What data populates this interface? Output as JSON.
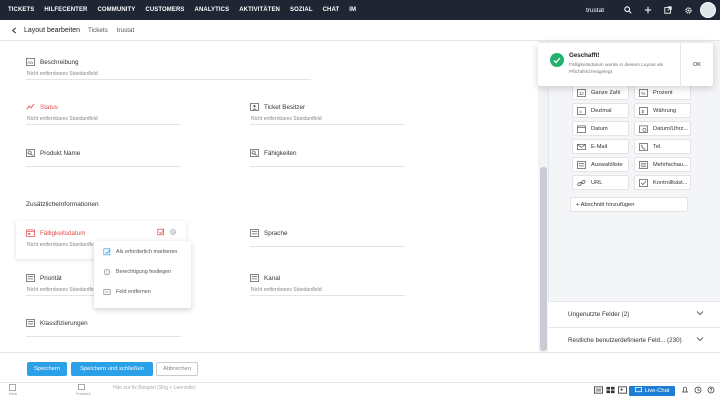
{
  "nav": {
    "items": [
      "TICKETS",
      "HILFECENTER",
      "COMMUNITY",
      "CUSTOMERS",
      "ANALYTICS",
      "AKTIVITÄTEN",
      "SOZIAL",
      "CHAT",
      "IM"
    ],
    "portal": "trustat"
  },
  "subheader": {
    "title": "Layout bearbeiten",
    "crumbs": [
      "Tickets",
      "trustat"
    ]
  },
  "fields": {
    "beschreibung": {
      "label": "Beschreibung",
      "hint": "Nicht entfernbares Standardfeld"
    },
    "status": {
      "label": "Status",
      "hint": "Nicht entfernbares Standardfeld"
    },
    "ticket_besitzer": {
      "label": "Ticket Besitzer",
      "hint": "Nicht entfernbares Standardfeld"
    },
    "produkt_name": {
      "label": "Produkt Name"
    },
    "faehigkeiten": {
      "label": "Fähigkeiten"
    },
    "faelligkeitsdatum": {
      "label": "Fälligkeitsdatum",
      "hint": "Nicht entfernbares Standardfeld"
    },
    "sprache": {
      "label": "Sprache"
    },
    "prioritaet": {
      "label": "Priorität",
      "hint": "Nicht entfernbares Standardfeld"
    },
    "kanal": {
      "label": "Kanal",
      "hint": "Nicht entfernbares Standardfeld"
    },
    "klassifizierungen": {
      "label": "Klassifizierungen"
    }
  },
  "section": {
    "title": "ZusätzlicheInformationen"
  },
  "context_menu": {
    "items": [
      "Als erforderlich markieren",
      "Berechtigung festlegen",
      "Feld entfernen"
    ]
  },
  "palette": {
    "tiles": [
      "Ganze Zahl",
      "Prozent",
      "Dezimal",
      "Währung",
      "Datum",
      "Datum/Uhrz...",
      "E-Mail",
      "Tel.",
      "Auswahlliste",
      "Mehrfachau...",
      "URL",
      "Kontrollkäst..."
    ],
    "add_section": "+ Abschnitt hinzufügen",
    "unused": "Ungenutzte Felder (2)",
    "remaining": "Restliche benutzerdefinierte Feld... (230)"
  },
  "toast": {
    "title": "Geschafft!",
    "message": "Fälligkeitsdatum wurde in diesem Layout als Pflichtfeld festgelegt.",
    "ok": "OK"
  },
  "footer": {
    "save": "Speichern",
    "save_close": "Speichern und schließen",
    "cancel": "Abbrechen"
  },
  "statusbar": {
    "left1": "Menü",
    "left2": "Feedback",
    "input_placeholder": "Hier zur fix Beispiel (Strg + Leerzeile)",
    "live_chat": "Live-Chat"
  },
  "colors": {
    "nav_bg": "#1f2533",
    "primary": "#2aa0e8",
    "success": "#23b26d",
    "required": "#e04b4b",
    "live_chat": "#1e7ed6"
  }
}
